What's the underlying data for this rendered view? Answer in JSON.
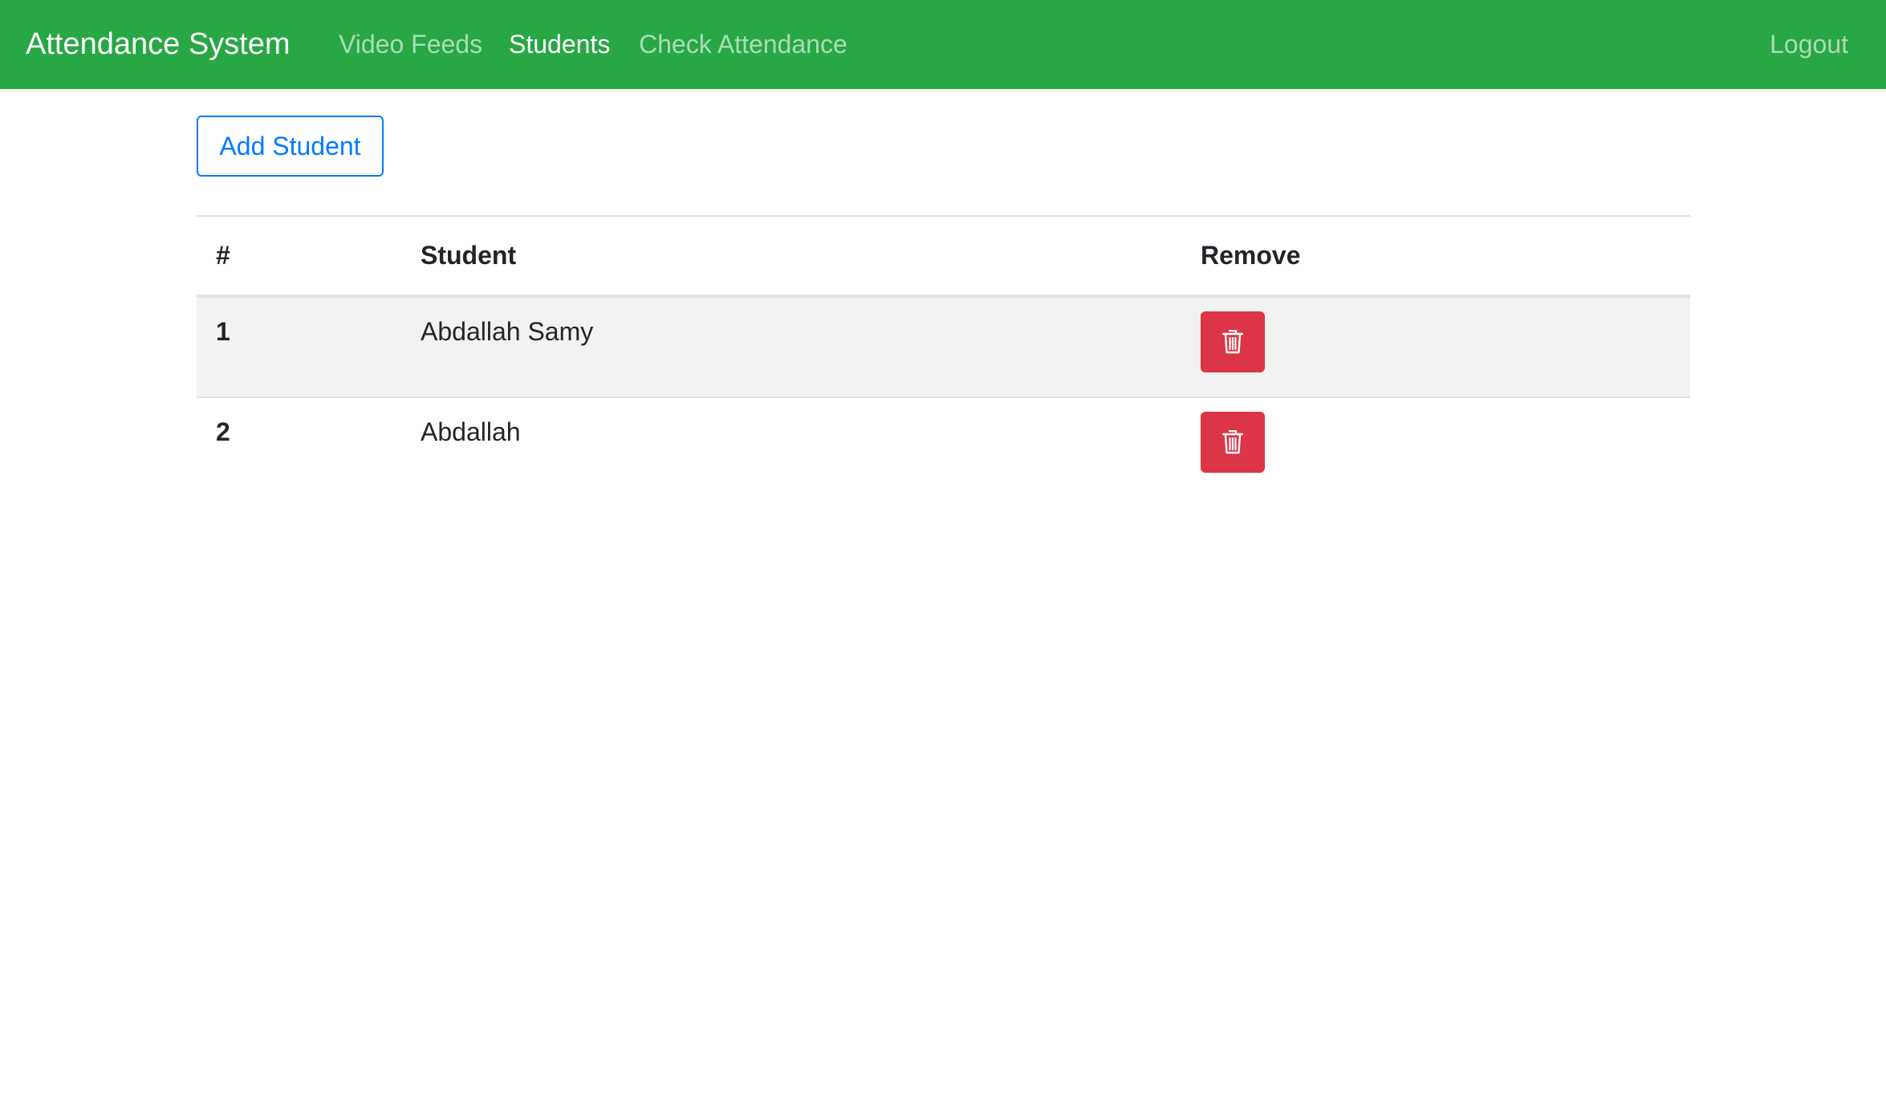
{
  "navbar": {
    "brand": "Attendance System",
    "links": [
      {
        "label": "Video Feeds",
        "active": false
      },
      {
        "label": "Students",
        "active": true
      },
      {
        "label": "Check Attendance",
        "active": false
      }
    ],
    "logout": "Logout",
    "color": "#28a745"
  },
  "toolbar": {
    "add_student_label": "Add Student",
    "accent": "#007bff"
  },
  "table": {
    "headers": [
      "#",
      "Student",
      "Remove"
    ],
    "rows": [
      {
        "num": "1",
        "name": "Abdallah Samy",
        "remove_icon": "trash-icon"
      },
      {
        "num": "2",
        "name": "Abdallah",
        "remove_icon": "trash-icon"
      }
    ],
    "danger_color": "#dc3545"
  }
}
